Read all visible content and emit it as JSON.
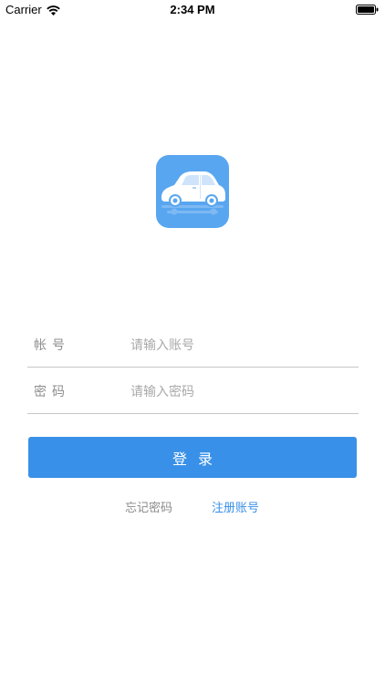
{
  "status_bar": {
    "carrier": "Carrier",
    "time": "2:34 PM"
  },
  "app": {
    "logo_icon": "car-icon",
    "logo_color": "#59a6f0"
  },
  "form": {
    "account": {
      "label": "帐号",
      "placeholder": "请输入账号",
      "value": ""
    },
    "password": {
      "label": "密码",
      "placeholder": "请输入密码",
      "value": ""
    },
    "login_label": "登录",
    "login_color": "#3990e8"
  },
  "links": {
    "forgot_password": "忘记密码",
    "register": "注册账号"
  }
}
